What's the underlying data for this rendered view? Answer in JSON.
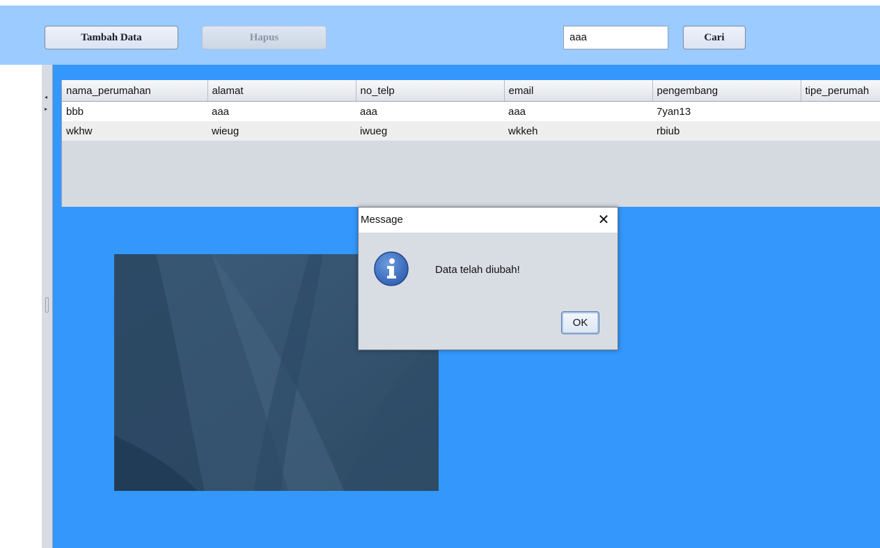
{
  "toolbar": {
    "add_label": "Tambah Data",
    "delete_label": "Hapus",
    "search_value": "aaa",
    "search_label": "Cari"
  },
  "table": {
    "columns": [
      "nama_perumahan",
      "alamat",
      "no_telp",
      "email",
      "pengembang",
      "tipe_perumah"
    ],
    "rows": [
      [
        "bbb",
        "aaa",
        "aaa",
        "aaa",
        "7yan13",
        ""
      ],
      [
        "wkhw",
        "wieug",
        "iwueg",
        "wkkeh",
        "rbiub",
        ""
      ]
    ]
  },
  "dialog": {
    "title": "Message",
    "message": "Data telah diubah!",
    "ok_label": "OK",
    "close_glyph": "✕",
    "icon": "info-icon"
  },
  "split_divider": {
    "left_arrow": "◂",
    "right_arrow": "▸"
  },
  "colors": {
    "top_panel": "#9ccbff",
    "main_area": "#3397fb",
    "dialog_bg": "#d8dce3",
    "info_icon": "#3a6fc4"
  }
}
